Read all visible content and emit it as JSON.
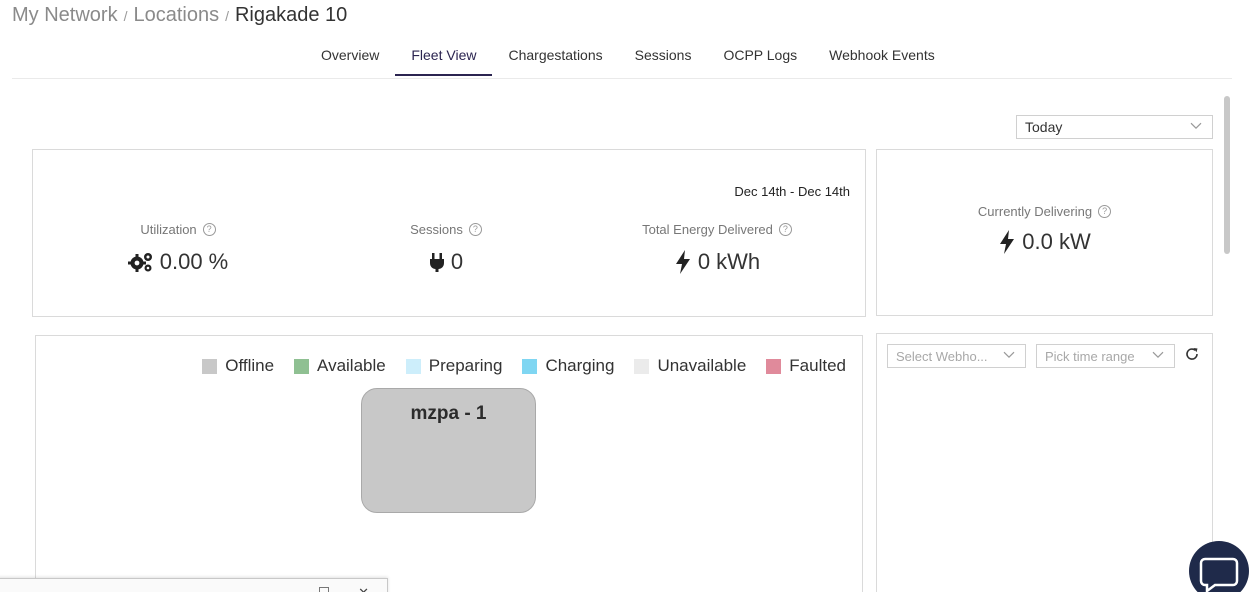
{
  "breadcrumb": {
    "items": [
      "My Network",
      "Locations"
    ],
    "current": "Rigakade 10",
    "separator": "/"
  },
  "tabs": [
    {
      "label": "Overview",
      "active": false
    },
    {
      "label": "Fleet View",
      "active": true
    },
    {
      "label": "Chargestations",
      "active": false
    },
    {
      "label": "Sessions",
      "active": false
    },
    {
      "label": "OCPP Logs",
      "active": false
    },
    {
      "label": "Webhook Events",
      "active": false
    }
  ],
  "period_select": {
    "value": "Today"
  },
  "stats": {
    "date_range": "Dec 14th - Dec 14th",
    "utilization": {
      "label": "Utilization",
      "value": "0.00 %",
      "icon": "gears-icon"
    },
    "sessions": {
      "label": "Sessions",
      "value": "0",
      "icon": "plug-icon"
    },
    "energy": {
      "label": "Total Energy Delivered",
      "value": "0 kWh",
      "icon": "bolt-icon"
    }
  },
  "currently_delivering": {
    "label": "Currently Delivering",
    "value": "0.0 kW",
    "icon": "bolt-icon"
  },
  "legend": [
    {
      "label": "Offline",
      "color": "#c8c8c8"
    },
    {
      "label": "Available",
      "color": "#8fc092"
    },
    {
      "label": "Preparing",
      "color": "#cdeefb"
    },
    {
      "label": "Charging",
      "color": "#7fd6f2"
    },
    {
      "label": "Unavailable",
      "color": "#ebebeb"
    },
    {
      "label": "Faulted",
      "color": "#e08a9b"
    }
  ],
  "station": {
    "name": "mzpa - 1",
    "status": "Offline"
  },
  "webhook_filters": {
    "event_select_placeholder": "Select Webho...",
    "time_range_placeholder": "Pick time range"
  },
  "colors": {
    "accent": "#2b2450",
    "chat_bubble": "#1f2a4a"
  }
}
